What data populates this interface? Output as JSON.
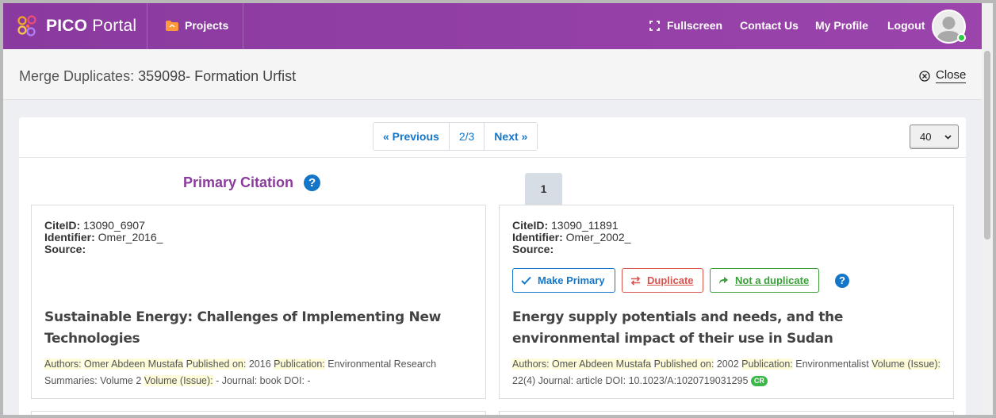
{
  "app": {
    "logo_bold": "PICO",
    "logo_light": "Portal",
    "nav": {
      "projects": "Projects",
      "fullscreen": "Fullscreen",
      "contact": "Contact Us",
      "profile": "My Profile",
      "logout": "Logout"
    }
  },
  "header": {
    "title_prefix": "Merge Duplicates: ",
    "title_project": "359098- Formation Urfist",
    "close_label": "Close"
  },
  "pager": {
    "previous": "« Previous",
    "count": "2/3",
    "next": "Next »",
    "page_size": "40"
  },
  "primary": {
    "heading": "Primary Citation",
    "cite_id_label": "CiteID:",
    "cite_id": "13090_6907",
    "identifier_label": "Identifier:",
    "identifier": "Omer_2016_",
    "source_label": "Source:",
    "source": "",
    "title": "Sustainable Energy: Challenges of Implementing New Technologies",
    "authors_label": "Authors:",
    "authors": "Omer Abdeen Mustafa",
    "published_label": "Published on:",
    "published": "2016",
    "publication_label": "Publication:",
    "publication": "Environmental Research Summaries: Volume 2",
    "volume_label": "Volume (Issue):",
    "volume": "- Journal: book DOI: -"
  },
  "candidate": {
    "tab": "1",
    "cite_id_label": "CiteID:",
    "cite_id": "13090_11891",
    "identifier_label": "Identifier:",
    "identifier": "Omer_2002_",
    "source_label": "Source:",
    "source": "",
    "make_primary": "Make Primary",
    "duplicate": "Duplicate",
    "not_duplicate": "Not a duplicate",
    "title": "Energy supply potentials and needs, and the environmental impact of their use in Sudan",
    "authors_label": "Authors:",
    "authors": "Omer Abdeen Mustafa",
    "published_label": "Published on:",
    "published": "2002",
    "publication_label": "Publication:",
    "publication": "Environmentalist",
    "volume_label": "Volume (Issue):",
    "volume": "22(4) Journal: article DOI: 10.1023/A:1020719031295",
    "cr_badge": "CR"
  },
  "colors": {
    "topbar": "#8e3aa0",
    "accent_blue": "#1476c9",
    "danger": "#d9534f",
    "success": "#3a9d3a",
    "heading_purple": "#8a3c9c"
  }
}
